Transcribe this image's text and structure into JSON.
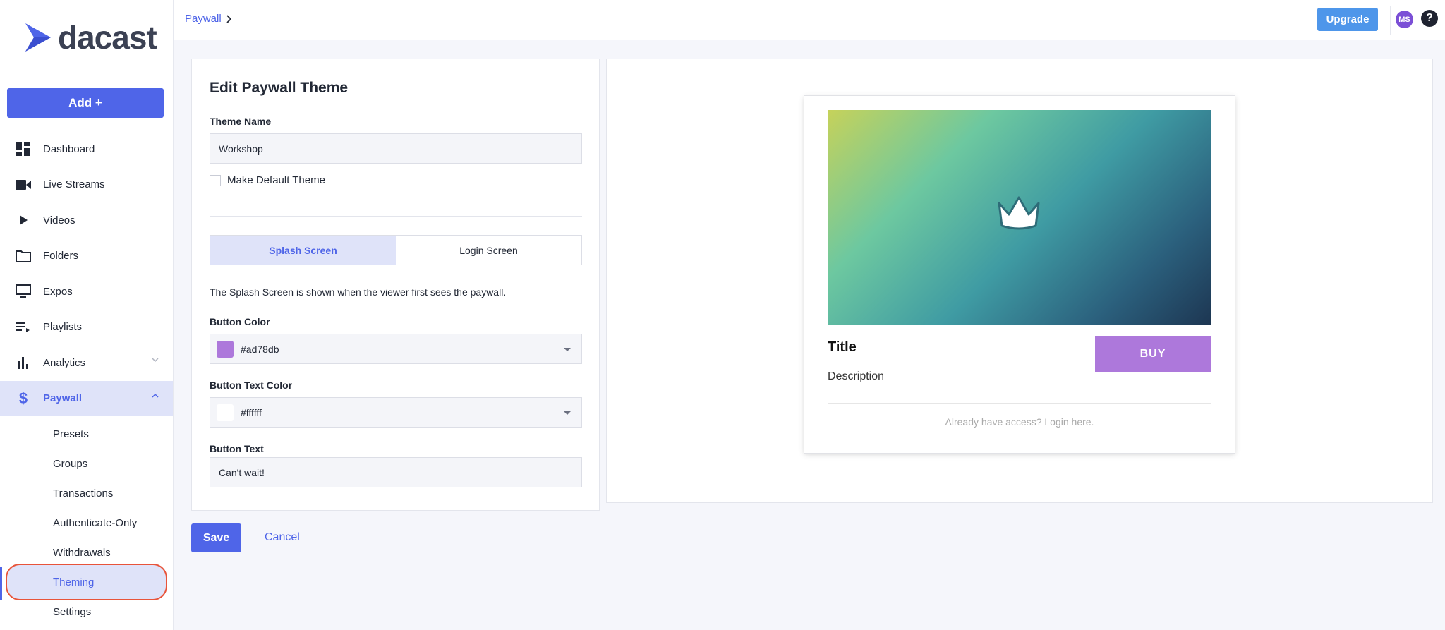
{
  "brand": {
    "name": "dacast",
    "primary_color": "#4f65e8"
  },
  "sidebar": {
    "add_label": "Add +",
    "items": [
      {
        "label": "Dashboard",
        "icon": "dashboard-icon"
      },
      {
        "label": "Live Streams",
        "icon": "video-camera-icon"
      },
      {
        "label": "Videos",
        "icon": "play-icon"
      },
      {
        "label": "Folders",
        "icon": "folder-icon"
      },
      {
        "label": "Expos",
        "icon": "monitor-icon"
      },
      {
        "label": "Playlists",
        "icon": "playlist-icon"
      },
      {
        "label": "Analytics",
        "icon": "bar-chart-icon"
      },
      {
        "label": "Paywall",
        "icon": "dollar-icon"
      }
    ],
    "paywall_sub": [
      "Presets",
      "Groups",
      "Transactions",
      "Authenticate-Only",
      "Withdrawals",
      "Theming",
      "Settings"
    ]
  },
  "topbar": {
    "breadcrumb": "Paywall",
    "upgrade_label": "Upgrade",
    "avatar_initials": "MS",
    "help_label": "?"
  },
  "editor": {
    "title": "Edit Paywall Theme",
    "theme_name_label": "Theme Name",
    "theme_name_value": "Workshop",
    "default_checkbox_label": "Make Default Theme",
    "tabs": [
      "Splash Screen",
      "Login Screen"
    ],
    "description": "The Splash Screen is shown when the viewer first sees the paywall.",
    "button_color_label": "Button Color",
    "button_color_value": "#ad78db",
    "button_text_color_label": "Button Text Color",
    "button_text_color_value": "#ffffff",
    "button_text_label": "Button Text",
    "button_text_value": "Can't wait!",
    "save_label": "Save",
    "cancel_label": "Cancel"
  },
  "preview": {
    "title": "Title",
    "description": "Description",
    "buy_label": "BUY",
    "login_text": "Already have access? Login here."
  }
}
